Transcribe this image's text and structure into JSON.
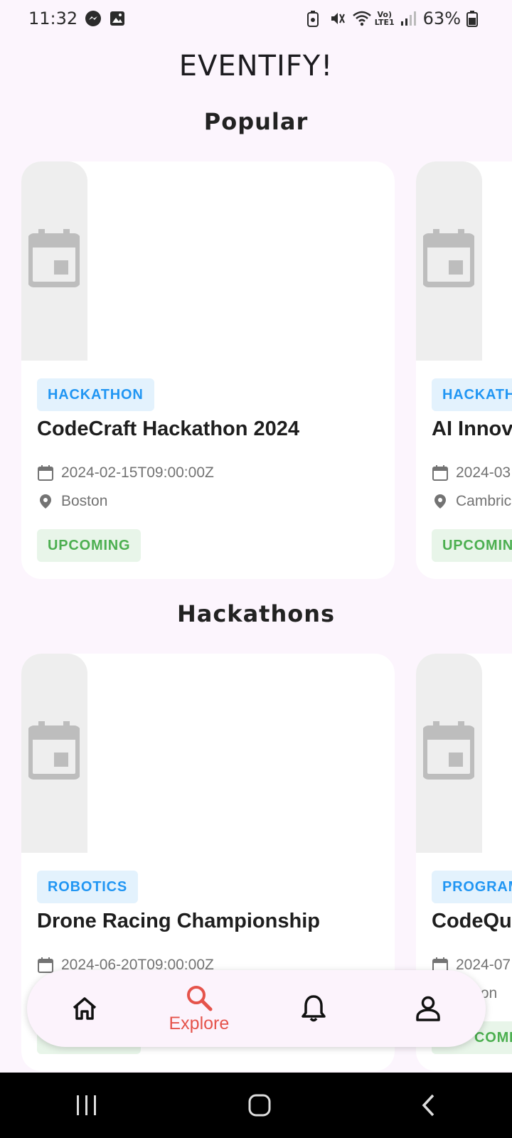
{
  "status_bar": {
    "time": "11:32",
    "battery": "63%"
  },
  "app": {
    "title": "EVENTIFY!"
  },
  "sections": [
    {
      "title": "Popular",
      "cards": [
        {
          "category": "HACKATHON",
          "title": "CodeCraft Hackathon 2024",
          "date": "2024-02-15T09:00:00Z",
          "location": "Boston",
          "status": "UPCOMING"
        },
        {
          "category": "HACKATH",
          "title": "AI Innov",
          "date": "2024-03",
          "location": "Cambric",
          "status": "UPCOMIN"
        }
      ]
    },
    {
      "title": "Hackathons",
      "cards": [
        {
          "category": "ROBOTICS",
          "title": "Drone Racing Championship",
          "date": "2024-06-20T09:00:00Z",
          "location": "",
          "status": ""
        },
        {
          "category": "PROGRAM",
          "title": "CodeQu",
          "date": "2024-07",
          "location": "ton",
          "status": "COMIN"
        }
      ]
    }
  ],
  "nav": {
    "active": "explore",
    "explore_label": "Explore"
  },
  "colors": {
    "background": "#fcf5fd",
    "accent": "#e5534b",
    "category_chip_bg": "#e3f2fd",
    "category_chip_text": "#2196f3",
    "status_chip_bg": "#e8f5e9",
    "status_chip_text": "#4caf50"
  },
  "icons": [
    "messenger-icon",
    "gallery-icon",
    "battery-saver-icon",
    "mute-icon",
    "wifi-icon",
    "volte-icon",
    "signal-icon",
    "battery-icon",
    "calendar-icon",
    "location-pin-icon",
    "home-icon",
    "search-icon",
    "bell-icon",
    "person-icon",
    "recent-apps-icon",
    "home-button-icon",
    "back-icon"
  ]
}
